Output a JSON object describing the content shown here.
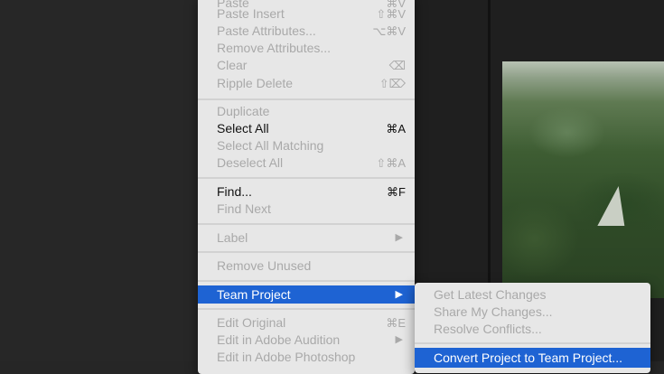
{
  "menu": {
    "items": [
      {
        "label": "Paste",
        "shortcut": "⌘V",
        "enabled": false
      },
      {
        "label": "Paste Insert",
        "shortcut": "⇧⌘V",
        "enabled": false
      },
      {
        "label": "Paste Attributes...",
        "shortcut": "⌥⌘V",
        "enabled": false
      },
      {
        "label": "Remove Attributes...",
        "shortcut": "",
        "enabled": false
      },
      {
        "label": "Clear",
        "shortcut": "⌫",
        "enabled": false
      },
      {
        "label": "Ripple Delete",
        "shortcut": "⇧⌦",
        "enabled": false
      },
      {
        "label": "Duplicate",
        "shortcut": "",
        "enabled": false
      },
      {
        "label": "Select All",
        "shortcut": "⌘A",
        "enabled": true
      },
      {
        "label": "Select All Matching",
        "shortcut": "",
        "enabled": false
      },
      {
        "label": "Deselect All",
        "shortcut": "⇧⌘A",
        "enabled": false
      },
      {
        "label": "Find...",
        "shortcut": "⌘F",
        "enabled": true
      },
      {
        "label": "Find Next",
        "shortcut": "",
        "enabled": false
      },
      {
        "label": "Label",
        "submenu_arrow": "▶",
        "enabled": false
      },
      {
        "label": "Remove Unused",
        "shortcut": "",
        "enabled": false
      },
      {
        "label": "Team Project",
        "submenu_arrow": "▶",
        "enabled": true,
        "highlighted": true
      },
      {
        "label": "Edit Original",
        "shortcut": "⌘E",
        "enabled": false
      },
      {
        "label": "Edit in Adobe Audition",
        "submenu_arrow": "▶",
        "enabled": false
      },
      {
        "label": "Edit in Adobe Photoshop",
        "shortcut": "",
        "enabled": false
      }
    ]
  },
  "submenu": {
    "items": [
      {
        "label": "Get Latest Changes",
        "enabled": false
      },
      {
        "label": "Share My Changes...",
        "enabled": false
      },
      {
        "label": "Resolve Conflicts...",
        "enabled": false
      },
      {
        "label": "Convert Project to Team Project...",
        "enabled": true,
        "highlighted": true
      }
    ]
  },
  "colors": {
    "highlight": "#1e63d3",
    "menu_bg": "#e7e7e7",
    "disabled_text": "#a9a9a9",
    "app_bg": "#262626"
  }
}
